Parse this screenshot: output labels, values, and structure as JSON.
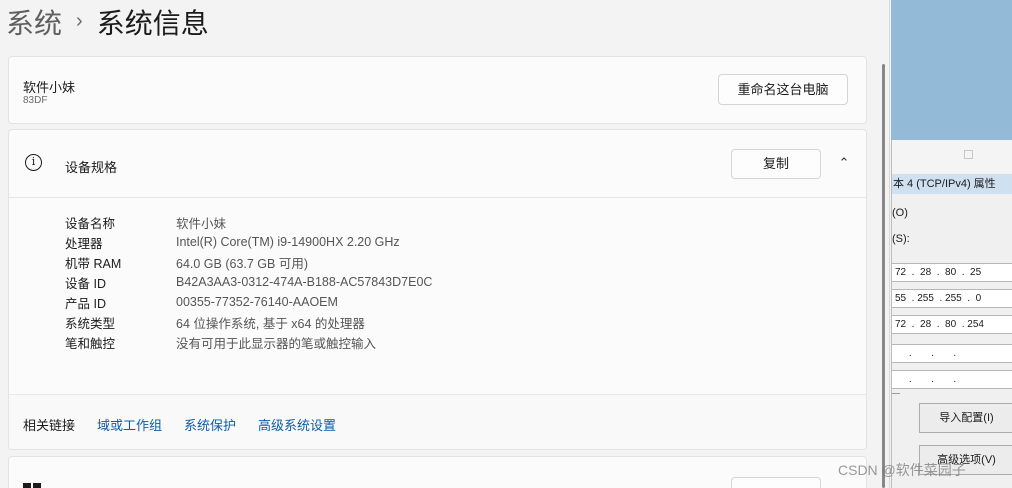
{
  "breadcrumb": {
    "parent": "系统",
    "separator": "›",
    "current": "系统信息"
  },
  "pc": {
    "name": "软件小妹",
    "model": "83DF",
    "rename_label": "重命名这台电脑"
  },
  "spec": {
    "title": "设备规格",
    "copy_label": "复制",
    "chevron": "⌃",
    "rows": [
      {
        "label": "设备名称",
        "value": "软件小妹"
      },
      {
        "label": "处理器",
        "value": "Intel(R) Core(TM) i9-14900HX   2.20 GHz"
      },
      {
        "label": "机带 RAM",
        "value": "64.0 GB (63.7 GB 可用)"
      },
      {
        "label": "设备 ID",
        "value": "B42A3AA3-0312-474A-B188-AC57843D7E0C"
      },
      {
        "label": "产品 ID",
        "value": "00355-77352-76140-AAOEM"
      },
      {
        "label": "系统类型",
        "value": "64 位操作系统, 基于 x64 的处理器"
      },
      {
        "label": "笔和触控",
        "value": "没有可用于此显示器的笔或触控输入"
      }
    ]
  },
  "links": {
    "label": "相关链接",
    "items": [
      "域或工作组",
      "系统保护",
      "高级系统设置"
    ]
  },
  "dialog": {
    "title": "本 4 (TCP/IPv4) 属性",
    "label_o": "(O)",
    "label_s": "(S):",
    "ip_address": "72  .  28  .  80  .  25",
    "subnet_mask": "55  . 255  . 255  .  0",
    "gateway": "72  .  28  .  80  . 254",
    "dns1": "     .       .       .",
    "dns2": "     .       .       .",
    "import_label": "导入配置(I)",
    "advanced_label": "高级选项(V)"
  },
  "watermark": "CSDN @软件菜园子"
}
